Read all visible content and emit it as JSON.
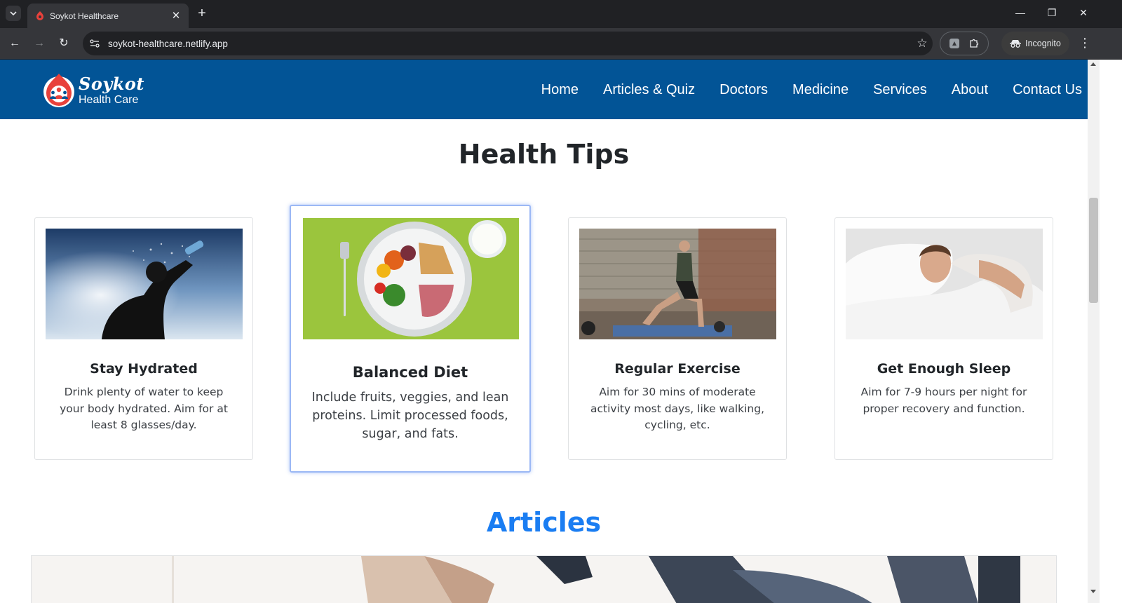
{
  "browser": {
    "tab_title": "Soykot Healthcare",
    "tab_close": "✕",
    "new_tab": "+",
    "url": "soykot-healthcare.netlify.app",
    "incognito_label": "Incognito",
    "window_controls": {
      "minimize": "—",
      "restore": "❐",
      "close": "✕"
    },
    "nav": {
      "back": "←",
      "forward": "→",
      "reload": "↻"
    },
    "star": "☆",
    "menu": "⋮"
  },
  "brand": {
    "name": "Soykot",
    "subtitle": "Health Care",
    "colors": {
      "navbar": "#025496",
      "logo_red": "#e8413b"
    }
  },
  "nav_links": [
    "Home",
    "Articles & Quiz",
    "Doctors",
    "Medicine",
    "Services",
    "About",
    "Contact Us"
  ],
  "health_tips": {
    "title": "Health Tips",
    "cards": [
      {
        "title": "Stay Hydrated",
        "text": "Drink plenty of water to keep your body hydrated. Aim for at least 8 glasses/day.",
        "image": "man-drinking-water"
      },
      {
        "title": "Balanced Diet",
        "text": "Include fruits, veggies, and lean proteins. Limit processed foods, sugar, and fats.",
        "image": "healthy-plate"
      },
      {
        "title": "Regular Exercise",
        "text": "Aim for 30 mins of moderate activity most days, like walking, cycling, etc.",
        "image": "man-lunge-exercise"
      },
      {
        "title": "Get Enough Sleep",
        "text": "Aim for 7-9 hours per night for proper recovery and function.",
        "image": "man-sleeping"
      }
    ]
  },
  "articles": {
    "title": "Articles",
    "title_color": "#1a7df2",
    "banner_image": "people-running-on-treadmills"
  }
}
